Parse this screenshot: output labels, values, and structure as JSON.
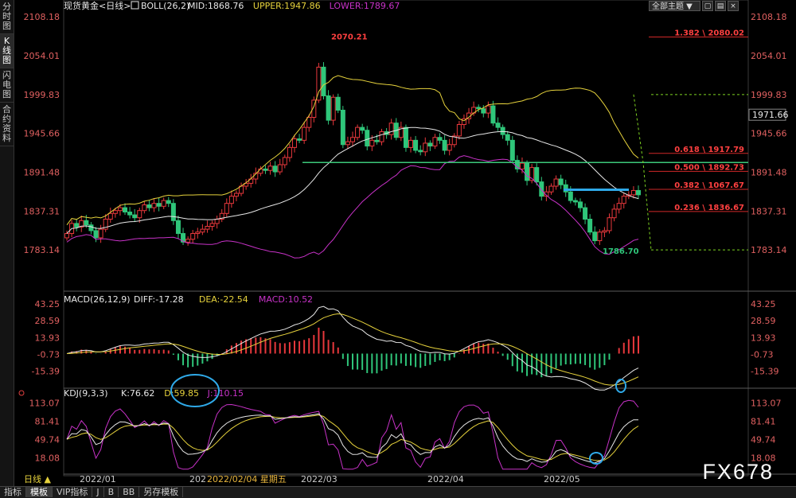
{
  "sidebar": {
    "items": [
      {
        "label": "分时图",
        "active": false
      },
      {
        "label": "K线图",
        "active": true
      },
      {
        "label": "闪电图",
        "active": false
      },
      {
        "label": "合约资料",
        "active": false
      }
    ]
  },
  "toolbar": {
    "theme_label": "全部主题 ▼",
    "icons": [
      "square-button",
      "horizontal-split-icon",
      "close-icon"
    ]
  },
  "bottom_tabs": [
    {
      "label": "指标",
      "active": false
    },
    {
      "label": "模板",
      "active": true
    },
    {
      "label": "VIP指标",
      "active": false
    },
    {
      "label": "J",
      "active": false
    },
    {
      "label": "B",
      "active": false
    },
    {
      "label": "BB",
      "active": false
    },
    {
      "label": "另存模板",
      "active": false
    }
  ],
  "watermark": "FX678",
  "chart_data": [
    {
      "type": "candlestick",
      "panel": "price",
      "title": "现货黄金<日线>",
      "indicator_label": "BOLL(26,2)",
      "legend": [
        {
          "label": "MID:1868.76",
          "color": "#e8e8e8"
        },
        {
          "label": "UPPER:1947.86",
          "color": "#e6d23c"
        },
        {
          "label": "LOWER:1789.67",
          "color": "#c832c8"
        }
      ],
      "y_ticks": [
        "2108.18",
        "2054.01",
        "1999.83",
        "1945.66",
        "1891.48",
        "1837.31",
        "1783.14"
      ],
      "current_price": "1971.66",
      "ylim": [
        1760,
        2115
      ],
      "x_labels": [
        "2022/01",
        "2022/02/04 星期五",
        "2022/03",
        "2022/04",
        "2022/05"
      ],
      "x_label_prefix": "202",
      "annotations": {
        "high": "2070.21",
        "low": "1786.70"
      },
      "fib_levels": [
        {
          "label": "1.382 \\ 2080.02",
          "value": 2080.02
        },
        {
          "label": "0.618 \\ 1917.79",
          "value": 1917.79
        },
        {
          "label": "0.500 \\ 1892.73",
          "value": 1892.73
        },
        {
          "label": "0.382 \\ 1067.67",
          "value": 1867.67
        },
        {
          "label": "0.236 \\ 1836.67",
          "value": 1836.67
        }
      ],
      "support_line": 1905,
      "projection_levels": [
        1999.83,
        1783.14
      ],
      "closes": [
        1806,
        1820,
        1815,
        1824,
        1818,
        1810,
        1800,
        1812,
        1826,
        1834,
        1838,
        1842,
        1836,
        1832,
        1828,
        1838,
        1846,
        1842,
        1848,
        1844,
        1852,
        1848,
        1824,
        1806,
        1794,
        1798,
        1806,
        1808,
        1812,
        1816,
        1820,
        1826,
        1834,
        1848,
        1858,
        1862,
        1872,
        1876,
        1882,
        1890,
        1896,
        1894,
        1900,
        1892,
        1902,
        1912,
        1926,
        1938,
        1936,
        1954,
        1968,
        1992,
        2038,
        1998,
        1964,
        1996,
        1978,
        1930,
        1934,
        1940,
        1954,
        1950,
        1928,
        1936,
        1934,
        1948,
        1944,
        1960,
        1940,
        1954,
        1926,
        1936,
        1922,
        1920,
        1932,
        1928,
        1940,
        1936,
        1922,
        1930,
        1942,
        1958,
        1966,
        1974,
        1982,
        1980,
        1974,
        1984,
        1960,
        1954,
        1944,
        1936,
        1908,
        1896,
        1904,
        1880,
        1898,
        1878,
        1858,
        1864,
        1872,
        1882,
        1874,
        1864,
        1852,
        1850,
        1842,
        1826,
        1808,
        1796,
        1808,
        1810,
        1828,
        1840,
        1848,
        1858,
        1860,
        1866,
        1860
      ],
      "series": [
        {
          "name": "MID",
          "color": "#e8e8e8"
        },
        {
          "name": "UPPER",
          "color": "#e6d23c"
        },
        {
          "name": "LOWER",
          "color": "#c832c8"
        }
      ]
    },
    {
      "type": "macd",
      "panel": "macd",
      "indicator_label": "MACD(26,12,9)",
      "legend": [
        {
          "label": "DIFF:-17.28",
          "color": "#e8e8e8"
        },
        {
          "label": "DEA:-22.54",
          "color": "#e6d23c"
        },
        {
          "label": "MACD:10.52",
          "color": "#c832c8"
        }
      ],
      "y_ticks": [
        "43.25",
        "28.59",
        "13.93",
        "-0.73",
        "-15.39"
      ],
      "ylim": [
        -28,
        48
      ]
    },
    {
      "type": "kdj",
      "panel": "kdj",
      "indicator_label": "KDJ(9,3,3)",
      "legend": [
        {
          "label": "K:76.62",
          "color": "#e8e8e8"
        },
        {
          "label": "D:59.85",
          "color": "#e6d23c"
        },
        {
          "label": "J:110.15",
          "color": "#c832c8"
        }
      ],
      "y_ticks": [
        "113.07",
        "81.41",
        "49.74",
        "18.08"
      ],
      "ylim": [
        -5,
        122
      ]
    }
  ]
}
